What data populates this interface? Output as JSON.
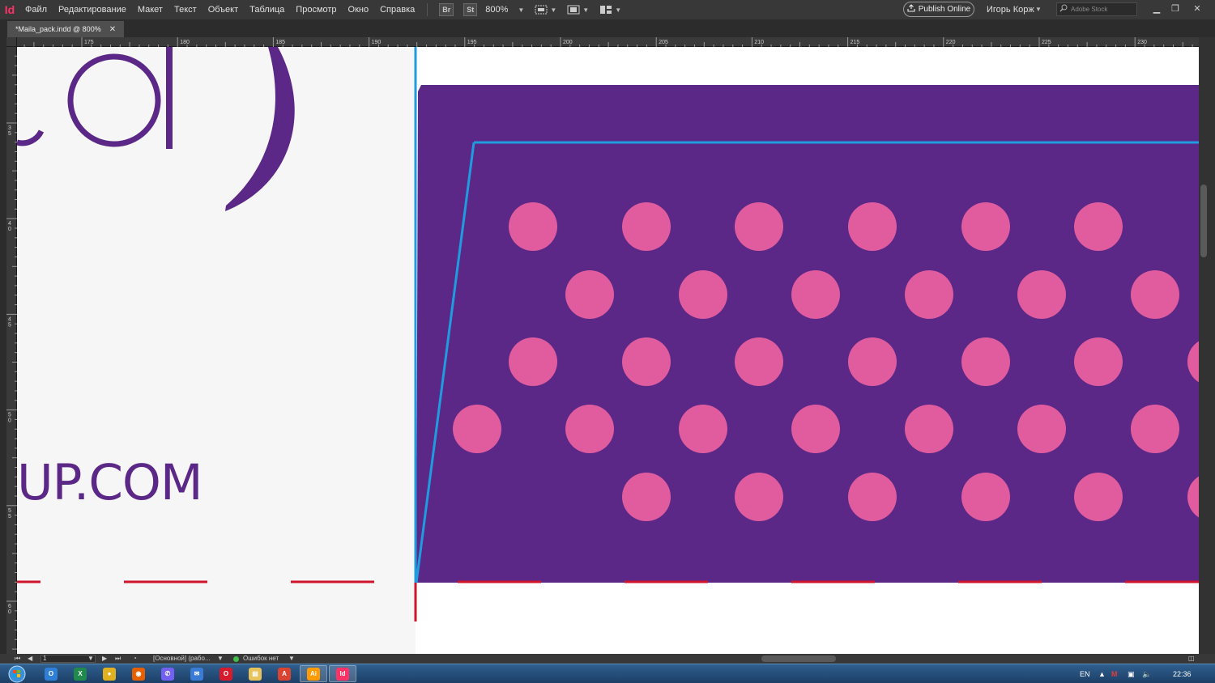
{
  "app": {
    "logo": "Id",
    "menu": [
      "Файл",
      "Редактирование",
      "Макет",
      "Текст",
      "Объект",
      "Таблица",
      "Просмотр",
      "Окно",
      "Справка"
    ],
    "bridge_label": "Br",
    "stock_label": "St",
    "zoom": "800%",
    "publish_label": "Publish Online",
    "user_name": "Игорь Корж",
    "search_placeholder": "Adobe Stock"
  },
  "document": {
    "tab_title": "*Maila_pack.indd @ 800%"
  },
  "rulers": {
    "horizontal": [
      175,
      180,
      185,
      190,
      195,
      200,
      205,
      210,
      215,
      220,
      225,
      230
    ],
    "vertical": [
      35,
      40,
      45,
      50,
      55,
      60
    ]
  },
  "canvas": {
    "url_text": "UP.COM",
    "colors": {
      "purple": "#5b2887",
      "pink": "#e05c9e",
      "frame_blue": "#1f9be0",
      "crop_red": "#d0142c",
      "paper": "#f6f6f6"
    }
  },
  "status": {
    "page": "1",
    "master": "[Основной] (рабо...",
    "preflight": "Ошибок нет"
  },
  "taskbar": {
    "apps": [
      "outlook-icon",
      "excel-icon",
      "chrome-icon",
      "firefox-icon",
      "viber-icon",
      "thunderbird-icon",
      "opera-icon",
      "explorer-icon",
      "acrobat-icon",
      "illustrator-icon",
      "indesign-icon"
    ],
    "language": "EN",
    "time": "22:36"
  }
}
